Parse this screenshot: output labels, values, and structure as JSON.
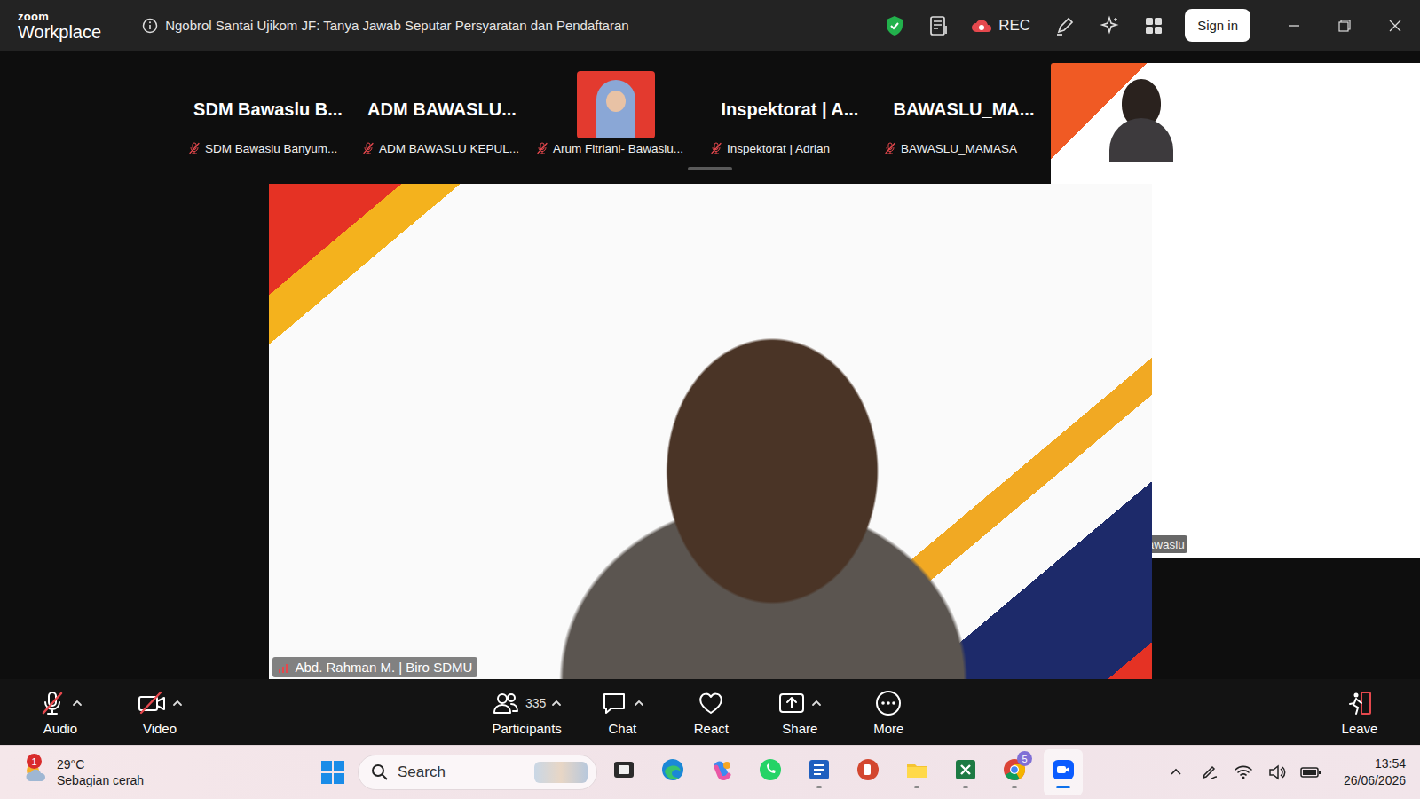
{
  "window": {
    "app_top": "zoom",
    "app_name": "Workplace",
    "title": "Ngobrol Santai Ujikom JF: Tanya Jawab Seputar Persyaratan dan Pendaftaran"
  },
  "title_bar": {
    "rec": "REC",
    "sign_in": "Sign in"
  },
  "strip": [
    {
      "kind": "name",
      "display": "SDM Bawaslu B...",
      "label": "SDM Bawaslu Banyum...",
      "muted": true
    },
    {
      "kind": "name",
      "display": "ADM BAWASLU...",
      "label": "ADM BAWASLU KEPUL...",
      "muted": true
    },
    {
      "kind": "photo",
      "label": "Arum Fitriani- Bawaslu...",
      "muted": true
    },
    {
      "kind": "name",
      "display": "Inspektorat | A...",
      "label": "Inspektorat | Adrian",
      "muted": true
    },
    {
      "kind": "name",
      "display": "BAWASLU_MA...",
      "label": "BAWASLU_MAMASA",
      "muted": true
    },
    {
      "kind": "video",
      "label": "Arisa- SDM Bawaslu",
      "muted": true
    }
  ],
  "main_video": {
    "name": "Abd. Rahman M. | Biro SDMU"
  },
  "toolbar": [
    {
      "kind": "audio",
      "label": "Audio",
      "muted": true,
      "caret": true
    },
    {
      "kind": "video",
      "label": "Video",
      "muted": true,
      "caret": true
    },
    {
      "kind": "participants",
      "label": "Participants",
      "count": "335",
      "caret": true
    },
    {
      "kind": "chat",
      "label": "Chat",
      "caret": true
    },
    {
      "kind": "react",
      "label": "React",
      "caret": false
    },
    {
      "kind": "share",
      "label": "Share",
      "caret": true
    },
    {
      "kind": "more",
      "label": "More",
      "caret": false
    }
  ],
  "leave": {
    "label": "Leave"
  },
  "taskbar": {
    "weather": {
      "temp": "29°C",
      "desc": "Sebagian cerah",
      "badge": "1"
    },
    "search": {
      "placeholder": "Search"
    },
    "apps": [
      {
        "kind": "taskview",
        "running": false,
        "selected": false
      },
      {
        "kind": "edge",
        "running": false,
        "selected": false
      },
      {
        "kind": "copilot",
        "running": false,
        "selected": false
      },
      {
        "kind": "whatsapp",
        "running": false,
        "selected": false
      },
      {
        "kind": "word",
        "running": true,
        "selected": false
      },
      {
        "kind": "powerpoint",
        "running": false,
        "selected": false
      },
      {
        "kind": "files",
        "running": true,
        "selected": false
      },
      {
        "kind": "excel",
        "running": true,
        "selected": false
      },
      {
        "kind": "chrome",
        "running": true,
        "selected": false,
        "badge": "5"
      },
      {
        "kind": "zoom",
        "running": true,
        "selected": true
      }
    ],
    "time": "13:54",
    "date": "26/06/2026"
  }
}
